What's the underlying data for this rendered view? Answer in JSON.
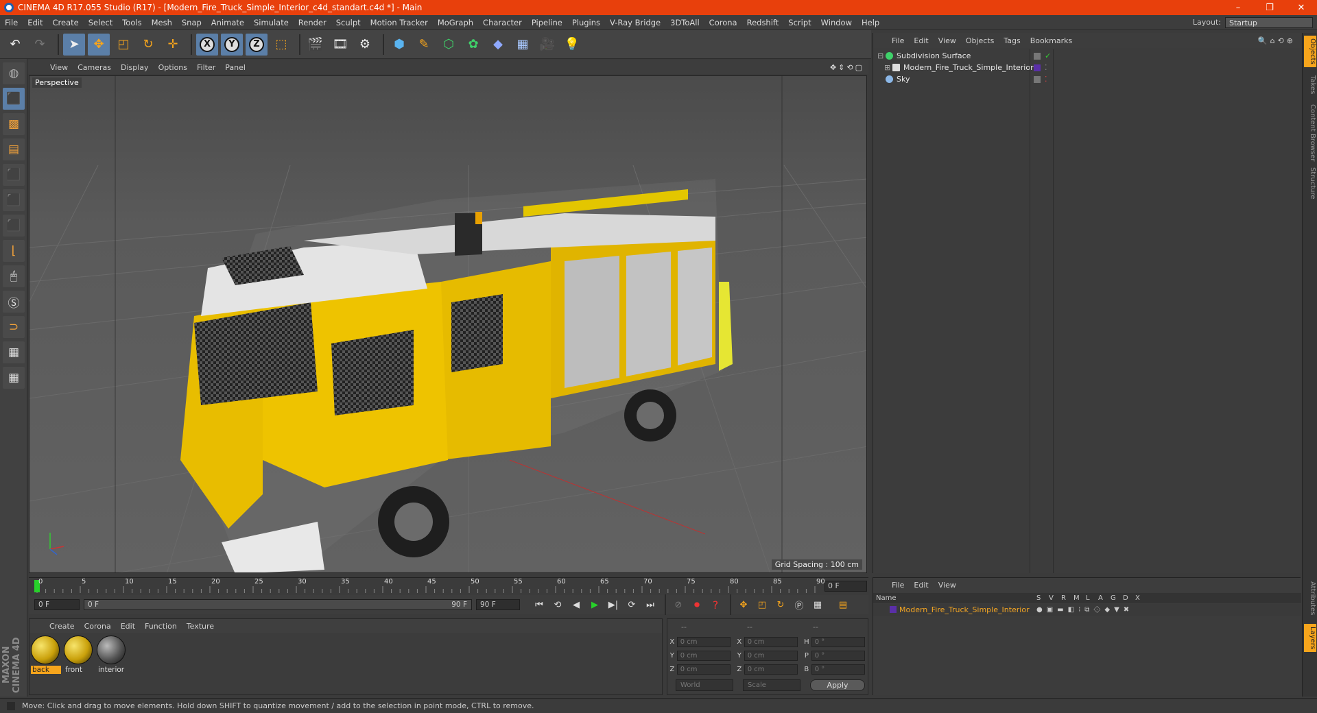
{
  "window": {
    "title": "CINEMA 4D R17.055 Studio (R17) - [Modern_Fire_Truck_Simple_Interior_c4d_standart.c4d *] - Main"
  },
  "menubar": {
    "items": [
      "File",
      "Edit",
      "Create",
      "Select",
      "Tools",
      "Mesh",
      "Snap",
      "Animate",
      "Simulate",
      "Render",
      "Sculpt",
      "Motion Tracker",
      "MoGraph",
      "Character",
      "Pipeline",
      "Plugins",
      "V-Ray Bridge",
      "3DToAll",
      "Corona",
      "Redshift",
      "Script",
      "Window",
      "Help"
    ],
    "layout_label": "Layout:",
    "layout_value": "Startup"
  },
  "toolbar": {
    "axis_x": "X",
    "axis_y": "Y",
    "axis_z": "Z"
  },
  "viewport": {
    "menu": [
      "View",
      "Cameras",
      "Display",
      "Options",
      "Filter",
      "Panel"
    ],
    "label": "Perspective",
    "grid_spacing": "Grid Spacing : 100 cm"
  },
  "timeline": {
    "ticks": [
      "0",
      "5",
      "10",
      "15",
      "20",
      "25",
      "30",
      "35",
      "40",
      "45",
      "50",
      "55",
      "60",
      "65",
      "70",
      "75",
      "80",
      "85",
      "90"
    ],
    "current_frame": "0 F"
  },
  "transport": {
    "start_field": "0 F",
    "range_start": "0 F",
    "range_end": "90 F",
    "end_field": "90 F"
  },
  "materials": {
    "menu": [
      "Create",
      "Corona",
      "Edit",
      "Function",
      "Texture"
    ],
    "items": [
      {
        "name": "back"
      },
      {
        "name": "front"
      },
      {
        "name": "interior"
      }
    ]
  },
  "coordinates": {
    "headers": [
      "--",
      "--",
      "--"
    ],
    "rows": [
      {
        "a1": "X",
        "v1": "0 cm",
        "a2": "X",
        "v2": "0 cm",
        "a3": "H",
        "v3": "0 °"
      },
      {
        "a1": "Y",
        "v1": "0 cm",
        "a2": "Y",
        "v2": "0 cm",
        "a3": "P",
        "v3": "0 °"
      },
      {
        "a1": "Z",
        "v1": "0 cm",
        "a2": "Z",
        "v2": "0 cm",
        "a3": "B",
        "v3": "0 °"
      }
    ],
    "mode_world": "World",
    "mode_scale": "Scale",
    "apply": "Apply"
  },
  "objects": {
    "menu": [
      "File",
      "Edit",
      "View",
      "Objects",
      "Tags",
      "Bookmarks"
    ],
    "items": [
      {
        "name": "Subdivision Surface"
      },
      {
        "name": "Modern_Fire_Truck_Simple_Interior"
      },
      {
        "name": "Sky"
      }
    ]
  },
  "layers": {
    "menu": [
      "File",
      "Edit",
      "View"
    ],
    "headers": {
      "name": "Name",
      "s": "S",
      "v": "V",
      "r": "R",
      "m": "M",
      "l": "L",
      "a": "A",
      "g": "G",
      "d": "D",
      "x": "X"
    },
    "row": "Modern_Fire_Truck_Simple_Interior"
  },
  "sidetabs": [
    "Objects",
    "Takes",
    "Content Browser",
    "Structure",
    "Attributes",
    "Layers"
  ],
  "logo": {
    "brand": "MAXON CINEMA 4D"
  },
  "status": "Move: Click and drag to move elements. Hold down SHIFT to quantize movement / add to the selection in point mode, CTRL to remove.",
  "colors": {
    "titlebar": "#e8400c",
    "accent": "#f7a51c",
    "selection": "#5b7fa8"
  }
}
